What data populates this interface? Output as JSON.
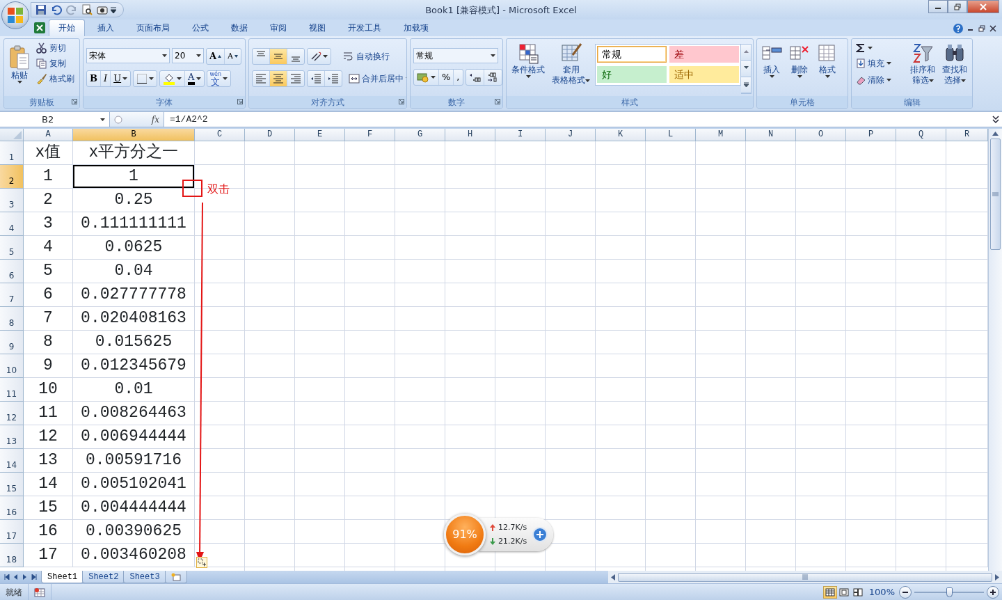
{
  "title_bar": {
    "title": "Book1  [兼容模式] - Microsoft Excel"
  },
  "ribbon_tabs": [
    {
      "label": "开始",
      "selected": true
    },
    {
      "label": "插入",
      "selected": false
    },
    {
      "label": "页面布局",
      "selected": false
    },
    {
      "label": "公式",
      "selected": false
    },
    {
      "label": "数据",
      "selected": false
    },
    {
      "label": "审阅",
      "selected": false
    },
    {
      "label": "视图",
      "selected": false
    },
    {
      "label": "开发工具",
      "selected": false
    },
    {
      "label": "加载项",
      "selected": false
    }
  ],
  "clipboard": {
    "paste": "粘贴",
    "cut": "剪切",
    "copy": "复制",
    "format_painter": "格式刷",
    "group": "剪贴板"
  },
  "font": {
    "name": "宋体",
    "size": "20",
    "grow": "A",
    "shrink": "A",
    "style_buttons": [
      {
        "kind": "bold",
        "label": "B"
      },
      {
        "kind": "italic",
        "label": "I"
      },
      {
        "kind": "underline",
        "label": "U"
      }
    ],
    "font_color": "A",
    "phonetic_top": "wén",
    "phonetic": "文",
    "group": "字体"
  },
  "alignment": {
    "vertical_buttons": [
      {
        "kind": "top",
        "selected": false
      },
      {
        "kind": "middle",
        "selected": true
      },
      {
        "kind": "bottom",
        "selected": false
      }
    ],
    "horizontal_buttons": [
      {
        "kind": "left",
        "selected": false
      },
      {
        "kind": "center",
        "selected": true
      },
      {
        "kind": "right",
        "selected": false
      }
    ],
    "wrap": "自动换行",
    "merge": "合并后居中",
    "group": "对齐方式"
  },
  "number": {
    "format": "常规",
    "percent": "%",
    "comma": ",",
    "group": "数字"
  },
  "styles": {
    "conditional": [
      "条件格式"
    ],
    "table": [
      "套用",
      "表格格式"
    ],
    "cell_styles": [
      {
        "kind": "normal",
        "label": "常规",
        "color": "#ffffff",
        "selected": true
      },
      {
        "kind": "bad",
        "label": "差",
        "color": "#ffc7ce",
        "selected": false
      },
      {
        "kind": "good",
        "label": "好",
        "color": "#c6efce",
        "selected": false
      },
      {
        "kind": "neutral",
        "label": "适中",
        "color": "#ffeb9c",
        "selected": false
      }
    ],
    "group": "样式"
  },
  "cells": {
    "insert": "插入",
    "delete": "删除",
    "format": "格式",
    "group": "单元格"
  },
  "editing": {
    "fill": "填充",
    "clear": "清除",
    "sort": [
      "排序和",
      "筛选"
    ],
    "find": [
      "查找和",
      "选择"
    ],
    "group": "编辑"
  },
  "formula_bar": {
    "name_box": "B2",
    "function_label": "fx",
    "formula": "=1/A2^2"
  },
  "sheet": {
    "columns": [
      {
        "label": "A",
        "selected": false
      },
      {
        "label": "B",
        "selected": true
      },
      {
        "label": "C",
        "selected": false
      },
      {
        "label": "D",
        "selected": false
      },
      {
        "label": "E",
        "selected": false
      },
      {
        "label": "F",
        "selected": false
      },
      {
        "label": "G",
        "selected": false
      },
      {
        "label": "H",
        "selected": false
      },
      {
        "label": "I",
        "selected": false
      },
      {
        "label": "J",
        "selected": false
      },
      {
        "label": "K",
        "selected": false
      },
      {
        "label": "L",
        "selected": false
      },
      {
        "label": "M",
        "selected": false
      },
      {
        "label": "N",
        "selected": false
      },
      {
        "label": "O",
        "selected": false
      },
      {
        "label": "P",
        "selected": false
      },
      {
        "label": "Q",
        "selected": false
      },
      {
        "label": "R",
        "selected": false
      }
    ],
    "rows": [
      {
        "header": "1",
        "selected": false,
        "cells": [
          "x值",
          "x平方分之一"
        ]
      },
      {
        "header": "2",
        "selected": true,
        "cells": [
          "1",
          "1"
        ]
      },
      {
        "header": "3",
        "selected": false,
        "cells": [
          "2",
          "0.25"
        ]
      },
      {
        "header": "4",
        "selected": false,
        "cells": [
          "3",
          "0.111111111"
        ]
      },
      {
        "header": "5",
        "selected": false,
        "cells": [
          "4",
          "0.0625"
        ]
      },
      {
        "header": "6",
        "selected": false,
        "cells": [
          "5",
          "0.04"
        ]
      },
      {
        "header": "7",
        "selected": false,
        "cells": [
          "6",
          "0.027777778"
        ]
      },
      {
        "header": "8",
        "selected": false,
        "cells": [
          "7",
          "0.020408163"
        ]
      },
      {
        "header": "9",
        "selected": false,
        "cells": [
          "8",
          "0.015625"
        ]
      },
      {
        "header": "10",
        "selected": false,
        "cells": [
          "9",
          "0.012345679"
        ]
      },
      {
        "header": "11",
        "selected": false,
        "cells": [
          "10",
          "0.01"
        ]
      },
      {
        "header": "12",
        "selected": false,
        "cells": [
          "11",
          "0.008264463"
        ]
      },
      {
        "header": "13",
        "selected": false,
        "cells": [
          "12",
          "0.006944444"
        ]
      },
      {
        "header": "14",
        "selected": false,
        "cells": [
          "13",
          "0.00591716"
        ]
      },
      {
        "header": "15",
        "selected": false,
        "cells": [
          "14",
          "0.005102041"
        ]
      },
      {
        "header": "16",
        "selected": false,
        "cells": [
          "15",
          "0.004444444"
        ]
      },
      {
        "header": "17",
        "selected": false,
        "cells": [
          "16",
          "0.00390625"
        ]
      },
      {
        "header": "18",
        "selected": false,
        "cells": [
          "17",
          "0.003460208"
        ]
      }
    ]
  },
  "annotation": {
    "label": "双击"
  },
  "floating_widget": {
    "percent": "91%",
    "upload": "12.7K/s",
    "download": "21.2K/s"
  },
  "sheet_tabs": [
    {
      "label": "Sheet1",
      "selected": true
    },
    {
      "label": "Sheet2",
      "selected": false
    },
    {
      "label": "Sheet3",
      "selected": false
    }
  ],
  "status_bar": {
    "status": "就绪",
    "view_buttons": [
      {
        "kind": "normal",
        "selected": true
      },
      {
        "kind": "page_layout",
        "selected": false
      },
      {
        "kind": "page_break",
        "selected": false
      }
    ],
    "zoom": "100%",
    "zoom_slider": {
      "level": 0.5
    }
  }
}
